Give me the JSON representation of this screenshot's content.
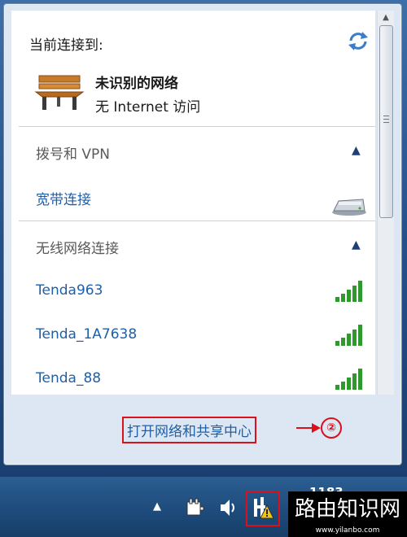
{
  "header": {
    "title": "当前连接到:"
  },
  "current_connection": {
    "name": "未识别的网络",
    "status": "无 Internet 访问"
  },
  "sections": {
    "dialup": {
      "title": "拨号和 VPN",
      "items": [
        {
          "label": "宽带连接"
        }
      ]
    },
    "wireless": {
      "title": "无线网络连接",
      "items": [
        {
          "label": "Tenda963"
        },
        {
          "label": "Tenda_1A7638"
        },
        {
          "label": "Tenda_88"
        }
      ]
    }
  },
  "footer": {
    "link": "打开网络和共享中心"
  },
  "annotation": {
    "step": "②"
  },
  "taskbar": {
    "clock": "1183"
  },
  "watermark": {
    "title": "路由知识网",
    "url": "www.yilanbo.com"
  },
  "icons": {
    "refresh": "refresh-icon",
    "network": "bench-icon",
    "broadband": "modem-icon",
    "signal": "signal-bars-icon"
  },
  "colors": {
    "link": "#1f5fa8",
    "highlight": "#d9111b",
    "signal": "#2e9a2e",
    "section": "#1c3f75"
  }
}
